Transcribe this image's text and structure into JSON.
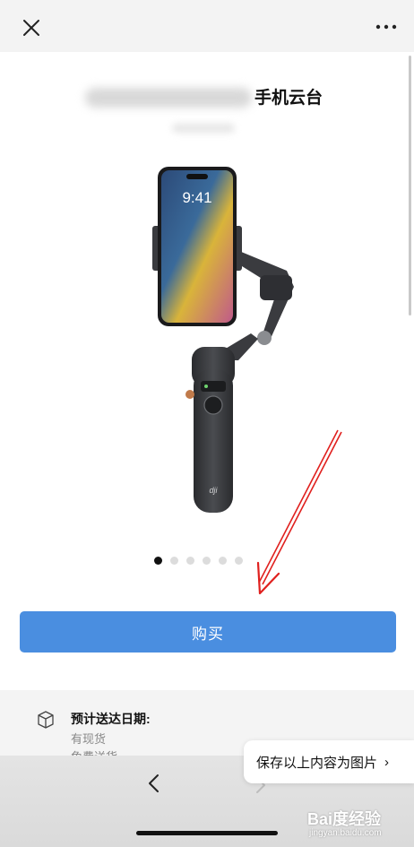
{
  "header": {
    "close_icon": "close-icon",
    "more_icon": "more-icon"
  },
  "product": {
    "title": "手机云台",
    "phone_time": "9:41",
    "brand_mark": "dji"
  },
  "carousel": {
    "total": 6,
    "active_index": 0
  },
  "buy": {
    "label": "购买"
  },
  "delivery": {
    "title": "预计送达日期:",
    "stock": "有现货",
    "shipping": "免费送货"
  },
  "nav": {
    "back_icon": "chevron-left-icon",
    "forward_icon": "chevron-right-icon"
  },
  "save_image": {
    "label": "保存以上内容为图片",
    "chevron": "›"
  },
  "watermark": {
    "brand": "Bai度经验",
    "url": "jingyan.baidu.com"
  },
  "colors": {
    "accent": "#4a8ee0",
    "annotation": "#e0201e"
  }
}
